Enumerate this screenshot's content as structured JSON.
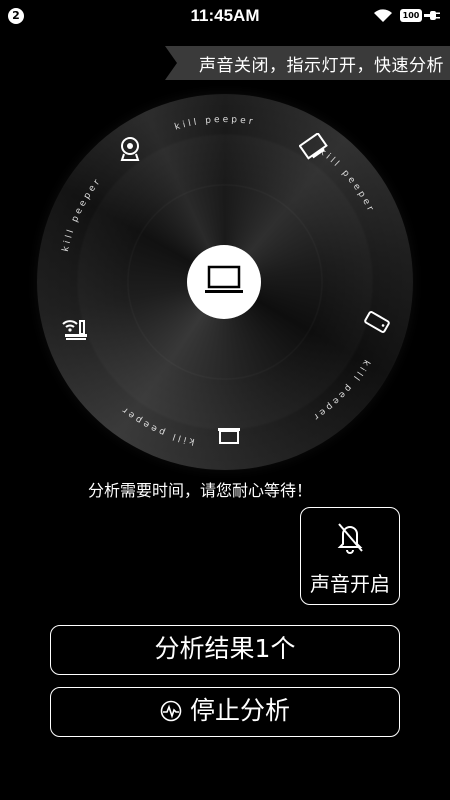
{
  "status_bar": {
    "notification_count": "2",
    "time": "11:45AM",
    "battery": "100",
    "icons": [
      "wifi-icon",
      "battery-icon",
      "charging-plug-icon"
    ]
  },
  "banner": {
    "text": "声音关闭，指示灯开，快速分析"
  },
  "disc": {
    "ring_label": "kill peeper",
    "center_icon": "laptop-icon",
    "device_icons": [
      "webcam-icon",
      "monitor-icon",
      "phone-icon",
      "projector-icon",
      "wifi-camera-icon"
    ]
  },
  "message": "分析需要时间，请您耐心等待！",
  "sound_button": {
    "label": "声音开启",
    "icon": "bell-muted-icon"
  },
  "result_button": {
    "label": "分析结果1个"
  },
  "stop_button": {
    "label": "停止分析",
    "icon": "pulse-icon"
  },
  "colors": {
    "background": "#000000",
    "banner": "#3a3a3a",
    "foreground": "#ffffff"
  }
}
